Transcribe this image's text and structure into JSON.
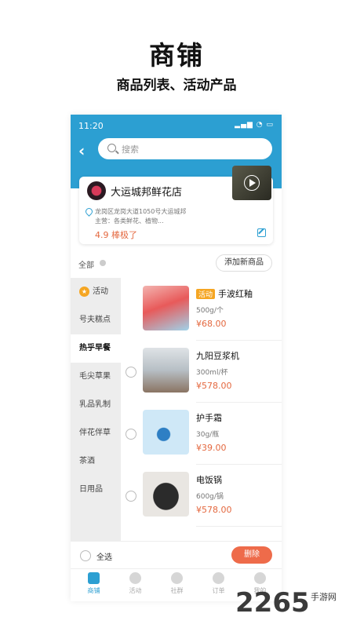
{
  "hero": {
    "title": "商铺",
    "subtitle": "商品列表、活动产品"
  },
  "status": {
    "time": "11:20"
  },
  "search": {
    "placeholder": "搜索"
  },
  "store": {
    "name": "大运城邦鲜花店",
    "address": "龙岗区龙岗大道1050号大运城邦",
    "business": "主营：各类鲜花、植物...",
    "rating": "4.9 棒极了"
  },
  "filter": {
    "all_label": "全部",
    "add_button": "添加新商品"
  },
  "categories": [
    {
      "label": "活动"
    },
    {
      "label": "号夫糕点"
    },
    {
      "label": "热乎早餐"
    },
    {
      "label": "毛尖草果"
    },
    {
      "label": "乳品乳制"
    },
    {
      "label": "伴花伴草"
    },
    {
      "label": "茶酒"
    },
    {
      "label": "日用品"
    }
  ],
  "products": [
    {
      "tag": "活动",
      "name": "手波红釉",
      "spec": "500g/个",
      "price": "¥68.00"
    },
    {
      "tag": "",
      "name": "九阳豆浆机",
      "spec": "300ml/杯",
      "price": "¥578.00"
    },
    {
      "tag": "",
      "name": "护手霜",
      "spec": "30g/瓶",
      "price": "¥39.00"
    },
    {
      "tag": "",
      "name": "电饭锅",
      "spec": "600g/锅",
      "price": "¥578.00"
    }
  ],
  "bottom": {
    "select_all": "全选",
    "delete": "删除"
  },
  "tabs": [
    {
      "label": "商铺"
    },
    {
      "label": "活动"
    },
    {
      "label": "社群"
    },
    {
      "label": "订单"
    },
    {
      "label": "我的"
    }
  ],
  "watermark": {
    "brand": "2265",
    "text": "手游网"
  },
  "colors": {
    "primary": "#2c9fd2",
    "accent": "#e4683f",
    "tag": "#f5a623"
  }
}
